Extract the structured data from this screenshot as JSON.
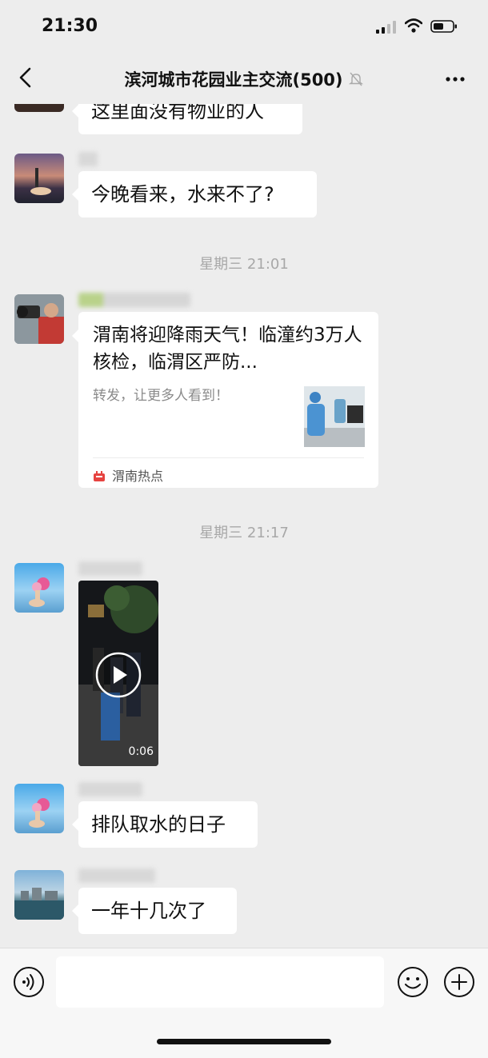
{
  "status_bar": {
    "time": "21:30"
  },
  "nav": {
    "title": "滨河城市花园业主交流(500)"
  },
  "messages": {
    "m0_text": "这里面没有物业的人",
    "m1_text": "今晚看来，水来不了?",
    "stamp1": "星期三 21:01",
    "card": {
      "title": "渭南将迎降雨天气！临潼约3万人核检，临渭区严防...",
      "desc": "转发，让更多人看到！",
      "source": "渭南热点"
    },
    "stamp2": "星期三 21:17",
    "video_duration": "0:06",
    "m4_text": "排队取水的日子",
    "m5_text": "一年十几次了"
  },
  "icons": {
    "back": "chevron-left-icon",
    "mute": "bell-off-icon",
    "more": "more-dots-icon",
    "voice": "voice-icon",
    "emoji": "emoji-icon",
    "plus": "plus-icon",
    "play": "play-icon"
  },
  "colors": {
    "background": "#ededed",
    "bubble": "#ffffff",
    "stamp": "#a8a8a8",
    "source_icon": "#e64340"
  }
}
